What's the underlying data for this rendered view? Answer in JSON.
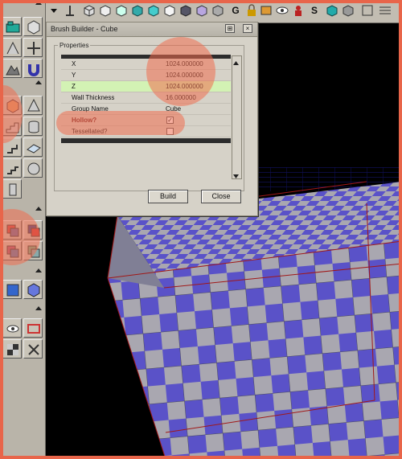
{
  "dialog": {
    "title": "Brush Builder - Cube",
    "group_label": "Properties",
    "properties": [
      {
        "key": "X",
        "value": "1024.000000"
      },
      {
        "key": "Y",
        "value": "1024.000000"
      },
      {
        "key": "Z",
        "value": "1024.000000"
      },
      {
        "key": "Wall Thickness",
        "value": "16.000000"
      },
      {
        "key": "Group Name",
        "value": "Cube"
      },
      {
        "key": "Hollow?",
        "value": "✓"
      },
      {
        "key": "Tessellated?",
        "value": ""
      }
    ],
    "build_label": "Build",
    "close_label": "Close"
  },
  "toolbar": {
    "letter_g": "G",
    "letter_s": "S"
  },
  "colors": {
    "highlight": "#e8654a",
    "checker_blue": "#5a52c8",
    "checker_gray": "#a9a7b0"
  }
}
